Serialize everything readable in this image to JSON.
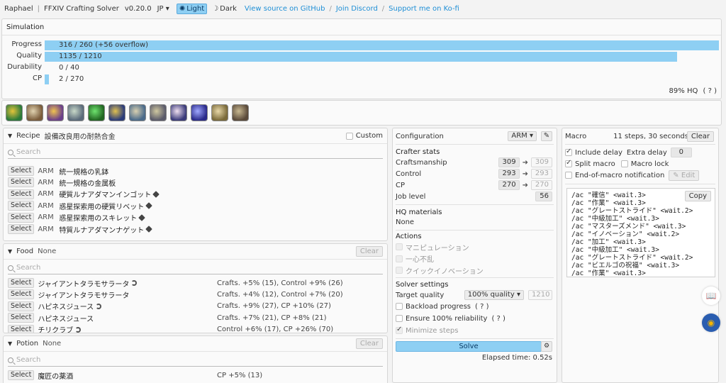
{
  "topbar": {
    "user": "Raphael",
    "app_title": "FFXIV Crafting Solver",
    "version": "v0.20.0",
    "language": "JP",
    "theme_light": "Light",
    "theme_dark": "Dark",
    "link_github": "View source on GitHub",
    "link_discord": "Join Discord",
    "link_kofi": "Support me on Ko-fi"
  },
  "simulation": {
    "title": "Simulation",
    "rows": [
      {
        "label": "Progress",
        "text": "316 / 260  (+56 overflow)",
        "fraction": 1.0
      },
      {
        "label": "Quality",
        "text": "1135 / 1210",
        "fraction": 0.938
      },
      {
        "label": "Durability",
        "text": "0 / 40",
        "fraction": 0
      },
      {
        "label": "CP",
        "text": "2 / 270",
        "fraction": 0.007
      }
    ],
    "hq_text": "89% HQ",
    "hq_help": "( ? )"
  },
  "skills": [
    "muscle-memory",
    "veneration",
    "waste-not",
    "groundwork",
    "manipulation",
    "innovation",
    "preparatory-touch",
    "basic-touch",
    "great-strides",
    "byregots-blessing",
    "careful-synthesis",
    "groundwork-2"
  ],
  "recipe": {
    "title": "Recipe",
    "name": "設備改良用の耐熱合金",
    "custom_label": "Custom",
    "search_placeholder": "Search",
    "select_label": "Select",
    "items": [
      {
        "job": "ARM",
        "name": "統一規格の乳鉢",
        "collectable": false
      },
      {
        "job": "ARM",
        "name": "統一規格の金属板",
        "collectable": false
      },
      {
        "job": "ARM",
        "name": "硬質ルナアダマンインゴット",
        "collectable": true
      },
      {
        "job": "ARM",
        "name": "惑星探索用の硬質リベット",
        "collectable": true
      },
      {
        "job": "ARM",
        "name": "惑星探索用のスキレット",
        "collectable": true
      },
      {
        "job": "ARM",
        "name": "特質ルナアダマンナゲット",
        "collectable": true
      }
    ]
  },
  "food": {
    "title": "Food",
    "value": "None",
    "clear_label": "Clear",
    "search_placeholder": "Search",
    "select_label": "Select",
    "items": [
      {
        "name": "ジャイアントタラモサラータ",
        "hq": true,
        "effect": "Crafts. +5% (15), Control +9% (26)"
      },
      {
        "name": "ジャイアントタラモサラータ",
        "hq": false,
        "effect": "Crafts. +4% (12), Control +7% (20)"
      },
      {
        "name": "ハピネスジュース",
        "hq": true,
        "effect": "Crafts. +9% (27), CP +10% (27)"
      },
      {
        "name": "ハピネスジュース",
        "hq": false,
        "effect": "Crafts. +7% (21), CP +8% (21)"
      },
      {
        "name": "チリクラブ",
        "hq": true,
        "effect": "Control +6% (17), CP +26% (70)"
      }
    ]
  },
  "potion": {
    "title": "Potion",
    "value": "None",
    "clear_label": "Clear",
    "search_placeholder": "Search",
    "select_label": "Select",
    "items": [
      {
        "name": "魔匠の薬酒",
        "effect": "CP +5% (13)"
      }
    ]
  },
  "configuration": {
    "title": "Configuration",
    "job": "ARM",
    "crafter_stats_title": "Crafter stats",
    "stats": [
      {
        "label": "Craftsmanship",
        "value": "309",
        "result": "309"
      },
      {
        "label": "Control",
        "value": "293",
        "result": "293"
      },
      {
        "label": "CP",
        "value": "270",
        "result": "270"
      }
    ],
    "job_level_label": "Job level",
    "job_level": "56",
    "hq_materials_title": "HQ materials",
    "hq_materials_value": "None",
    "actions_title": "Actions",
    "actions": [
      "マニピュレーション",
      "一心不乱",
      "クイックイノベーション"
    ],
    "solver_title": "Solver settings",
    "target_quality_label": "Target quality",
    "target_quality_option": "100% quality",
    "target_quality_value": "1210",
    "backload_label": "Backload progress",
    "ensure_label": "Ensure 100% reliability",
    "help": "( ? )",
    "minimize_label": "Minimize steps",
    "solve_label": "Solve",
    "elapsed": "Elapsed time: 0.52s"
  },
  "macro": {
    "title": "Macro",
    "summary": "11 steps, 30 seconds",
    "clear_label": "Clear",
    "include_delay": "Include delay",
    "extra_delay_label": "Extra delay",
    "extra_delay_value": "0",
    "split_macro": "Split macro",
    "macro_lock": "Macro lock",
    "end_notification": "End-of-macro notification",
    "edit_label": "Edit",
    "copy_label": "Copy",
    "lines": [
      "/ac \"確信\" <wait.3>",
      "/ac \"作業\" <wait.3>",
      "/ac \"グレートストライド\" <wait.2>",
      "/ac \"中級加工\" <wait.3>",
      "/ac \"マスターズメンド\" <wait.3>",
      "/ac \"イノベーション\" <wait.2>",
      "/ac \"加工\" <wait.3>",
      "/ac \"中級加工\" <wait.3>",
      "/ac \"グレートストライド\" <wait.2>",
      "/ac \"ビエルゴの祝福\" <wait.3>",
      "/ac \"作業\" <wait.3>"
    ]
  },
  "colors": {
    "accent": "#8ecff3",
    "link": "#1f8fd6"
  }
}
